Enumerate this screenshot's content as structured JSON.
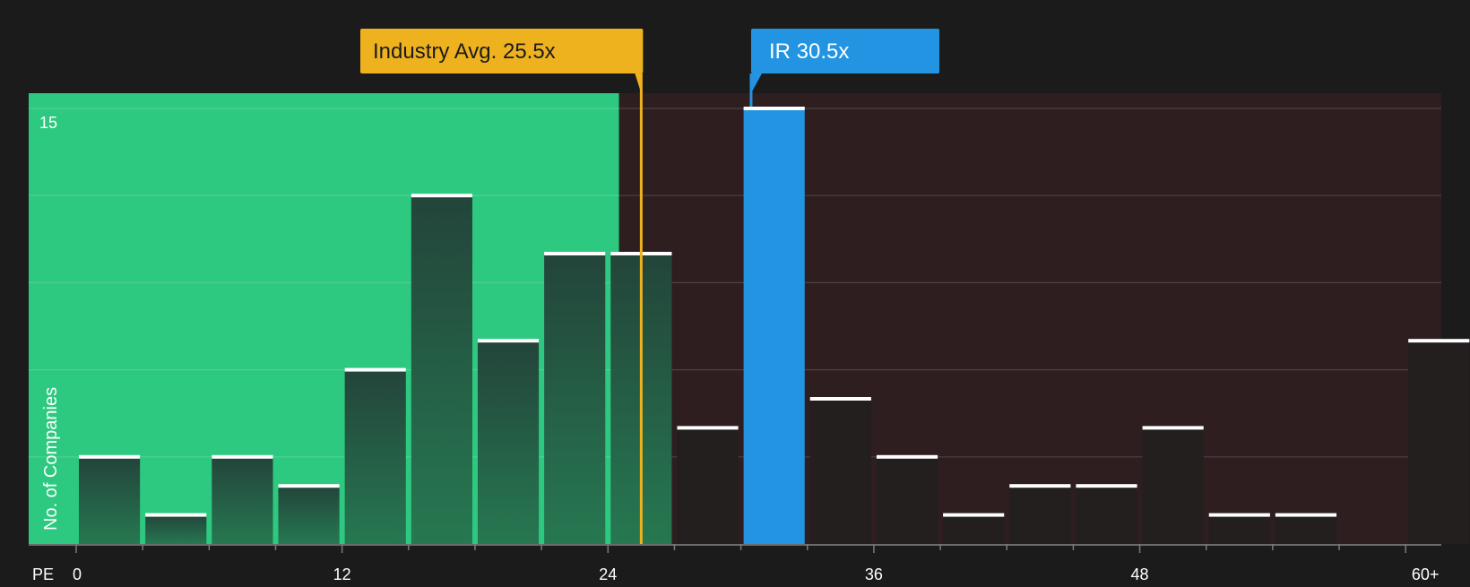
{
  "chart_data": {
    "type": "bar",
    "xlabel": "PE",
    "ylabel": "No. of Companies",
    "x_ticks": [
      "0",
      "12",
      "24",
      "36",
      "48",
      "60+"
    ],
    "y_ticks": [
      "15"
    ],
    "ylim": [
      0,
      15.5
    ],
    "bin_width": 3,
    "bins": [
      {
        "start": 0,
        "value": 3
      },
      {
        "start": 3,
        "value": 1
      },
      {
        "start": 6,
        "value": 3
      },
      {
        "start": 9,
        "value": 2
      },
      {
        "start": 12,
        "value": 6
      },
      {
        "start": 15,
        "value": 12
      },
      {
        "start": 18,
        "value": 7
      },
      {
        "start": 21,
        "value": 10
      },
      {
        "start": 24,
        "value": 10
      },
      {
        "start": 27,
        "value": 4
      },
      {
        "start": 30,
        "value": 15,
        "highlight": true
      },
      {
        "start": 33,
        "value": 5
      },
      {
        "start": 36,
        "value": 3
      },
      {
        "start": 39,
        "value": 1
      },
      {
        "start": 42,
        "value": 2
      },
      {
        "start": 45,
        "value": 2
      },
      {
        "start": 48,
        "value": 4
      },
      {
        "start": 51,
        "value": 1
      },
      {
        "start": 54,
        "value": 1
      },
      {
        "start": 60,
        "value": 7
      }
    ],
    "industry_avg": {
      "label": "Industry Avg. 25.5x",
      "value": 25.5
    },
    "company": {
      "label": "IR 30.5x",
      "value": 30.5
    },
    "fair_region_end": 24.5,
    "grid": true,
    "colors": {
      "background": "#1b1b1c",
      "fair_region": "#2ec980",
      "expensive_region": "#2e1e1f",
      "bar": "#244a37",
      "bar_dark": "#231f1f",
      "highlight": "#2394e1",
      "industry": "#eeb21f"
    }
  }
}
